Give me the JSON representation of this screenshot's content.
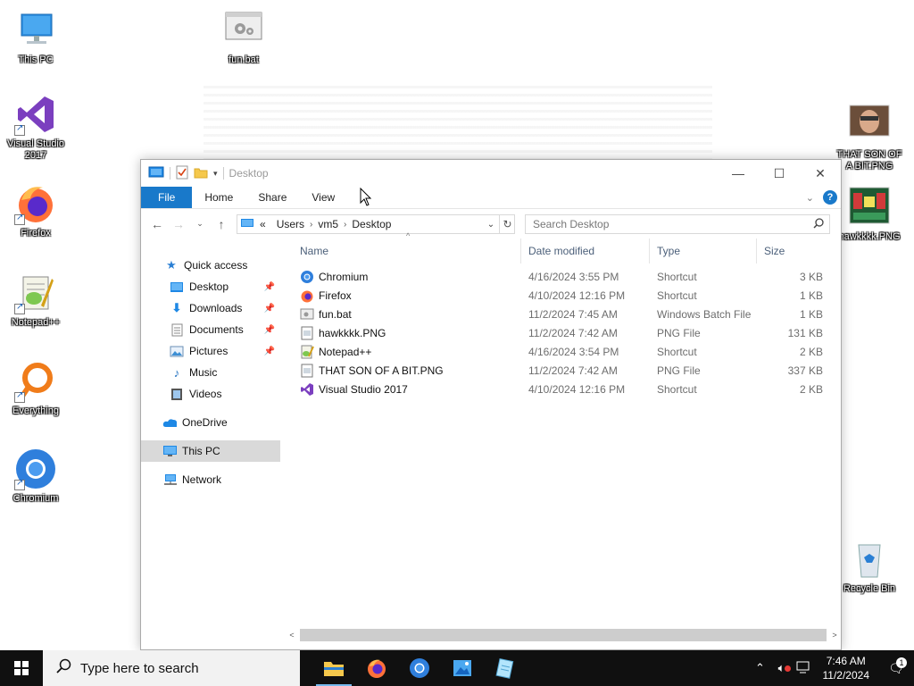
{
  "desktop": {
    "icons_left": [
      {
        "label": "This PC",
        "icon": "this-pc-icon"
      },
      {
        "label": "Visual Studio 2017",
        "icon": "visual-studio-icon"
      },
      {
        "label": "Firefox",
        "icon": "firefox-icon"
      },
      {
        "label": "Notepad++",
        "icon": "notepadpp-icon"
      },
      {
        "label": "Everything",
        "icon": "everything-icon"
      },
      {
        "label": "Chromium",
        "icon": "chromium-icon"
      }
    ],
    "icon_funbat": {
      "label": "fun.bat",
      "icon": "batch-file-icon"
    },
    "icons_right": [
      {
        "label": "THAT SON OF A BIT.PNG",
        "icon": "photo-thumbnail-icon"
      },
      {
        "label": "hawkkkk.PNG",
        "icon": "image-thumbnail-icon"
      },
      {
        "label": "Recycle Bin",
        "icon": "recycle-bin-icon"
      }
    ]
  },
  "explorer": {
    "title": "Desktop",
    "ribbon_tabs": [
      "File",
      "Home",
      "Share",
      "View"
    ],
    "help_label": "?",
    "breadcrumb_prefix": "«",
    "breadcrumb": [
      "Users",
      "vm5",
      "Desktop"
    ],
    "search_placeholder": "Search Desktop",
    "sidebar": [
      {
        "label": "Quick access",
        "icon": "star-icon",
        "indent": 0,
        "pinned": false
      },
      {
        "label": "Desktop",
        "icon": "desktop-folder-icon",
        "indent": 1,
        "pinned": true
      },
      {
        "label": "Downloads",
        "icon": "download-icon",
        "indent": 1,
        "pinned": true
      },
      {
        "label": "Documents",
        "icon": "documents-icon",
        "indent": 1,
        "pinned": true
      },
      {
        "label": "Pictures",
        "icon": "pictures-icon",
        "indent": 1,
        "pinned": true
      },
      {
        "label": "Music",
        "icon": "music-icon",
        "indent": 1,
        "pinned": false
      },
      {
        "label": "Videos",
        "icon": "videos-icon",
        "indent": 1,
        "pinned": false
      },
      {
        "label": "OneDrive",
        "icon": "onedrive-icon",
        "indent": 0,
        "pinned": false
      },
      {
        "label": "This PC",
        "icon": "this-pc-icon",
        "indent": 0,
        "pinned": false,
        "selected": true
      },
      {
        "label": "Network",
        "icon": "network-icon",
        "indent": 0,
        "pinned": false
      }
    ],
    "columns": [
      "Name",
      "Date modified",
      "Type",
      "Size"
    ],
    "files": [
      {
        "name": "Chromium",
        "date": "4/16/2024 3:55 PM",
        "type": "Shortcut",
        "size": "3 KB",
        "icon": "chromium-icon"
      },
      {
        "name": "Firefox",
        "date": "4/10/2024 12:16 PM",
        "type": "Shortcut",
        "size": "1 KB",
        "icon": "firefox-icon"
      },
      {
        "name": "fun.bat",
        "date": "11/2/2024 7:45 AM",
        "type": "Windows Batch File",
        "size": "1 KB",
        "icon": "batch-file-icon"
      },
      {
        "name": "hawkkkk.PNG",
        "date": "11/2/2024 7:42 AM",
        "type": "PNG File",
        "size": "131 KB",
        "icon": "image-file-icon"
      },
      {
        "name": "Notepad++",
        "date": "4/16/2024 3:54 PM",
        "type": "Shortcut",
        "size": "2 KB",
        "icon": "notepadpp-icon"
      },
      {
        "name": "THAT SON OF A BIT.PNG",
        "date": "11/2/2024 7:42 AM",
        "type": "PNG File",
        "size": "337 KB",
        "icon": "image-file-icon"
      },
      {
        "name": "Visual Studio 2017",
        "date": "4/10/2024 12:16 PM",
        "type": "Shortcut",
        "size": "2 KB",
        "icon": "visual-studio-icon"
      }
    ]
  },
  "taskbar": {
    "search_placeholder": "Type here to search",
    "apps": [
      "file-explorer-icon",
      "firefox-icon",
      "chromium-icon",
      "paint-icon",
      "notepad-icon"
    ],
    "time": "7:46 AM",
    "date": "11/2/2024",
    "notification_count": "1"
  },
  "colors": {
    "accent": "#1979ca",
    "taskbar": "#101010",
    "selected": "#d9d9d9"
  }
}
